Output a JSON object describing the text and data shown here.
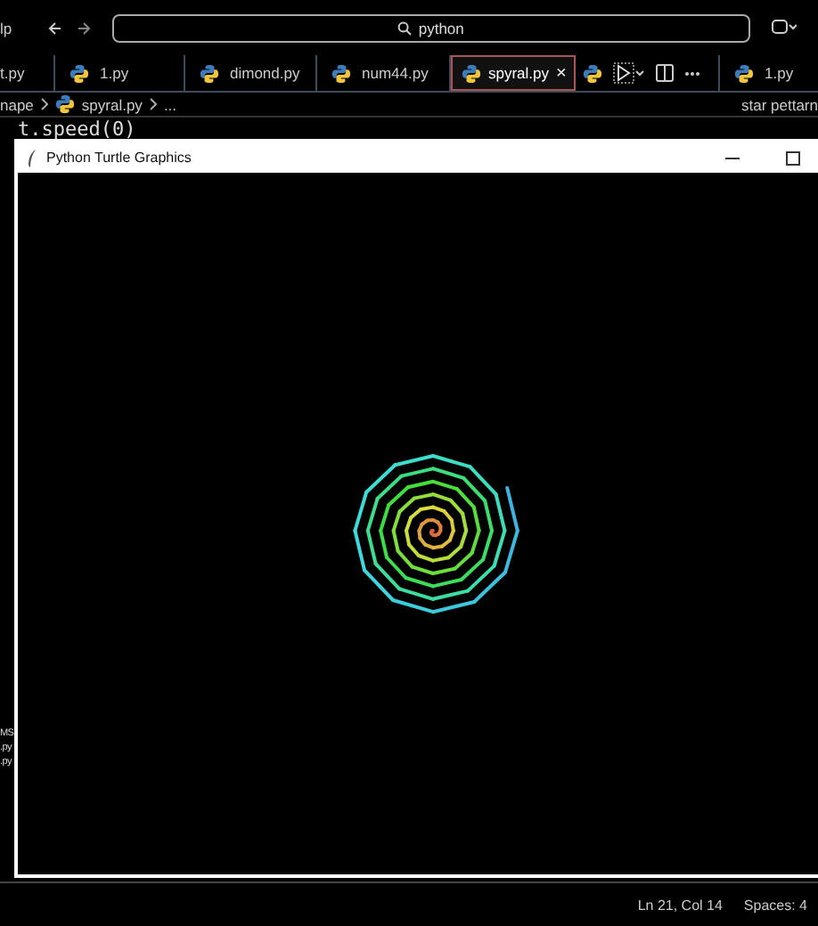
{
  "titlebar": {
    "menu_fragment": "lp",
    "search": {
      "value": "python"
    }
  },
  "tabs": [
    {
      "label": "t.py",
      "selected": false
    },
    {
      "label": "1.py",
      "selected": false
    },
    {
      "label": "dimond.py",
      "selected": false
    },
    {
      "label": "num44.py",
      "selected": false
    },
    {
      "label": "spyral.py",
      "selected": true,
      "close": "×"
    }
  ],
  "side_tab": {
    "label": "1.py"
  },
  "breadcrumb": [
    "nape",
    "spyral.py",
    "..."
  ],
  "side_breadcrumb": "star pettarn",
  "code_line": "t.speed(0)",
  "left_fragments": [
    "MS",
    ".py",
    ".py"
  ],
  "turtle_window": {
    "title": "Python Turtle Graphics"
  },
  "status_bar": {
    "position": "Ln 21, Col 14",
    "indent": "Spaces: 4"
  }
}
